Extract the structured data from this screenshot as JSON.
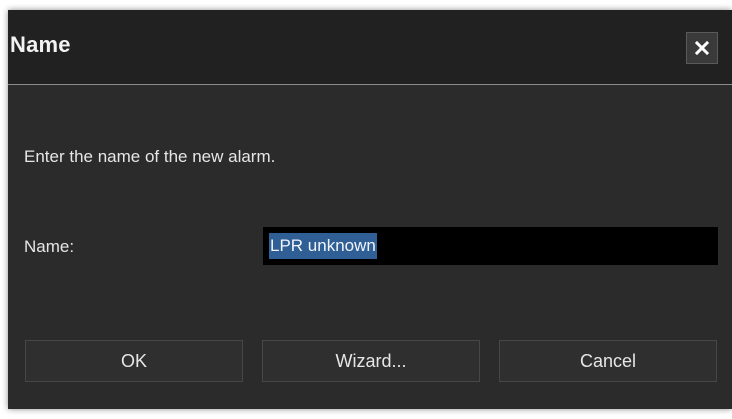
{
  "dialog": {
    "title": "Name",
    "close_icon": "close-icon",
    "instruction": "Enter the name of the new alarm.",
    "name_label": "Name:",
    "name_value": "LPR unknown",
    "buttons": {
      "ok": "OK",
      "wizard": "Wizard...",
      "cancel": "Cancel"
    }
  },
  "colors": {
    "background": "#2b2b2b",
    "titlebar": "#212121",
    "input_background": "#000000",
    "selection": "#2f5f95",
    "text": "#e6e6e6"
  }
}
